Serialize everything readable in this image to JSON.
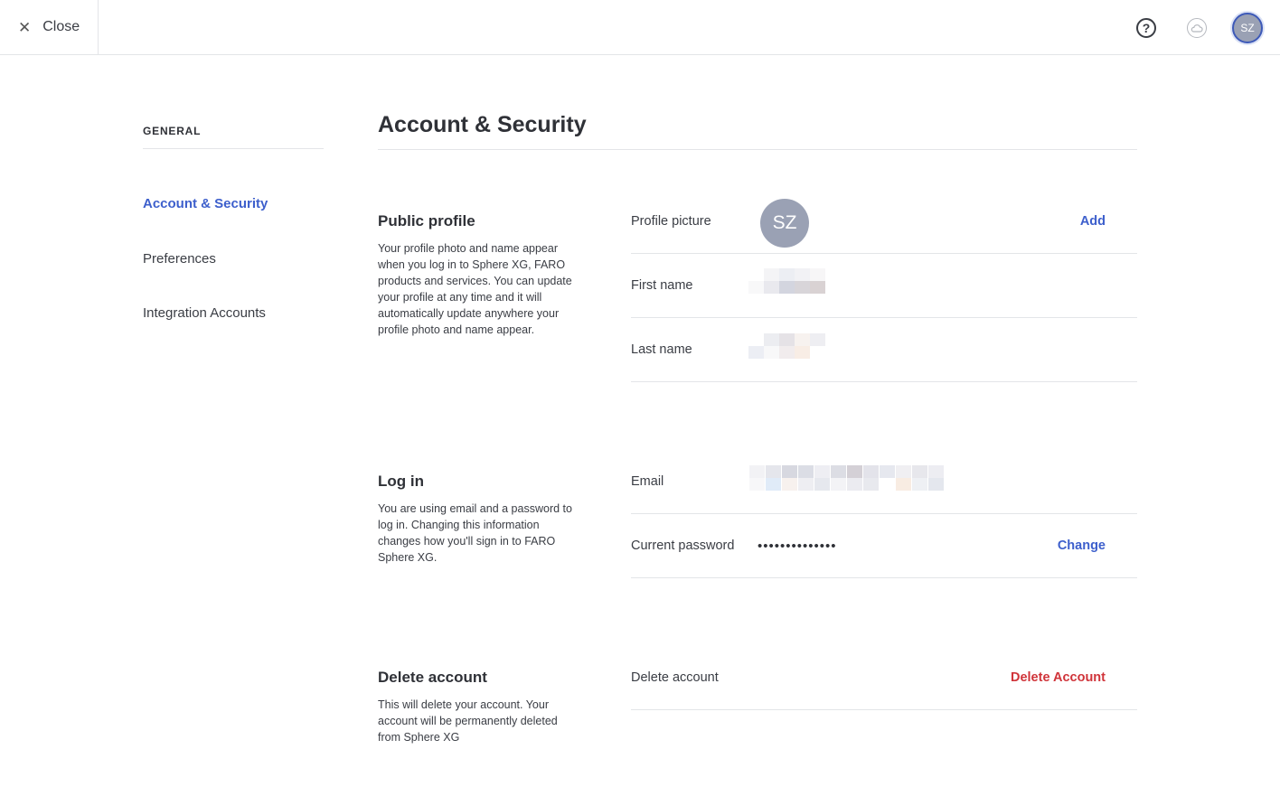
{
  "topbar": {
    "close_label": "Close",
    "icons": [
      "help-icon",
      "cloud-icon"
    ],
    "avatar_initials": "SZ"
  },
  "sidebar": {
    "section_title": "GENERAL",
    "items": [
      {
        "label": "Account & Security",
        "active": true
      },
      {
        "label": "Preferences",
        "active": false
      },
      {
        "label": "Integration Accounts",
        "active": false
      }
    ]
  },
  "main": {
    "title": "Account & Security",
    "public_profile": {
      "heading": "Public profile",
      "description": "Your profile photo and name appear when you log in to Sphere XG, FARO products and services. You can update your profile at any time and it will automatically update anywhere your profile photo and name appear.",
      "profile_picture_label": "Profile picture",
      "avatar_initials": "SZ",
      "add_label": "Add",
      "first_name_label": "First name",
      "last_name_label": "Last name"
    },
    "log_in": {
      "heading": "Log in",
      "description": "You are using email and a password to log in. Changing this information changes how you'll sign in to FARO Sphere XG.",
      "email_label": "Email",
      "password_label": "Current password",
      "password_value": "••••••••••••••",
      "change_label": "Change"
    },
    "delete": {
      "heading": "Delete account",
      "description": "This will delete your account. Your account will be permanently deleted from Sphere XG",
      "row_label": "Delete account",
      "action_label": "Delete Account"
    }
  },
  "colors": {
    "accent": "#3d5fcc",
    "danger": "#d0343a",
    "avatar": "#9aa1b4",
    "divider": "#e3e5e8"
  }
}
